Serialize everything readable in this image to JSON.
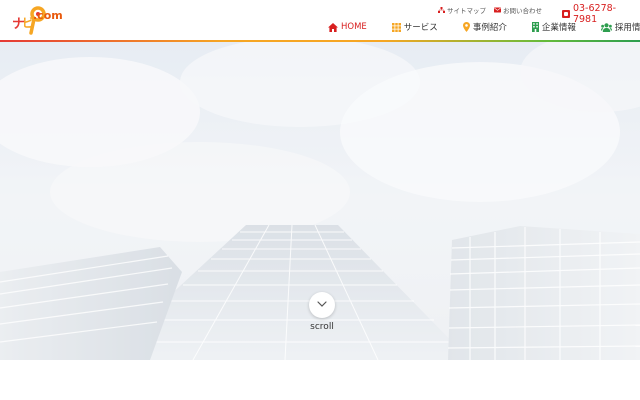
{
  "header": {
    "logo_text": ".com",
    "util_links": [
      {
        "label": "サイトマップ",
        "icon": "sitemap-icon"
      },
      {
        "label": "お問い合わせ",
        "icon": "mail-icon"
      }
    ],
    "phone": "03-6278-7981"
  },
  "nav": {
    "items": [
      {
        "label": "HOME",
        "icon": "home-icon"
      },
      {
        "label": "サービス",
        "icon": "grid-icon"
      },
      {
        "label": "事例紹介",
        "icon": "map-pin-icon"
      },
      {
        "label": "企業情報",
        "icon": "building-icon"
      },
      {
        "label": "採用情報",
        "icon": "users-icon"
      }
    ]
  },
  "hero": {
    "scroll_label": "scroll"
  },
  "colors": {
    "brand_red": "#d81f1f",
    "brand_orange": "#e8590c",
    "accent_yellow": "#f6a623",
    "accent_green": "#2e9e4f"
  }
}
